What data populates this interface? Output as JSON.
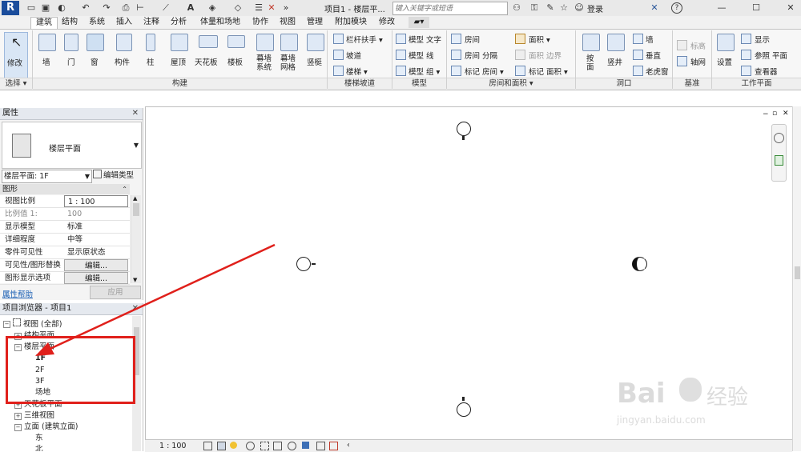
{
  "app": {
    "title": "项目1 - 楼层平...",
    "search_placeholder": "键入关键字或短语",
    "login": "登录"
  },
  "tabs": [
    "建筑",
    "结构",
    "系统",
    "插入",
    "注释",
    "分析",
    "体量和场地",
    "协作",
    "视图",
    "管理",
    "附加模块",
    "修改"
  ],
  "ribbon": {
    "modify": "修改",
    "select": "选择",
    "build": {
      "wall": "墙",
      "door": "门",
      "window": "窗",
      "component": "构件",
      "column": "柱",
      "roof": "屋顶",
      "ceiling": "天花板",
      "floor": "楼板",
      "curtain_system": "幕墙\n系统",
      "curtain_grid": "幕墙\n网格",
      "mullion": "竖梃"
    },
    "stairs": {
      "railing": "栏杆扶手",
      "ramp": "坡道",
      "stair": "楼梯"
    },
    "model": {
      "text": "模型 文字",
      "line": "模型 线",
      "group": "模型 组"
    },
    "room": {
      "room": "房间",
      "separator": "房间 分隔",
      "tag_room": "标记 房间",
      "area": "面积",
      "area_boundary": "面积 边界",
      "tag_area": "标记 面积"
    },
    "opening": {
      "by_face": "按\n面",
      "shaft": "竖井",
      "wall": "墙",
      "vertical": "垂直",
      "dormer": "老虎窗"
    },
    "datum": {
      "level": "标高",
      "grid": "轴网"
    },
    "workplane": {
      "set": "设置",
      "show": "显示",
      "ref_plane": "参照 平面",
      "viewer": "查看器"
    },
    "groups": {
      "build": "构建",
      "stairs": "楼梯坡道",
      "model": "模型",
      "room": "房间和面积",
      "opening": "洞口",
      "datum": "基准",
      "workplane": "工作平面"
    }
  },
  "properties": {
    "title": "属性",
    "type_name": "楼层平面",
    "selector": "楼层平面: 1F",
    "edit_type": "编辑类型",
    "section": "图形",
    "rows": [
      {
        "key": "视图比例",
        "value": "1 : 100"
      },
      {
        "key": "比例值 1:",
        "value": "100"
      },
      {
        "key": "显示模型",
        "value": "标准"
      },
      {
        "key": "详细程度",
        "value": "中等"
      },
      {
        "key": "零件可见性",
        "value": "显示原状态"
      },
      {
        "key": "可见性/图形替换",
        "value": "编辑..."
      },
      {
        "key": "图形显示选项",
        "value": "编辑..."
      }
    ],
    "help": "属性帮助",
    "apply": "应用"
  },
  "browser": {
    "title": "项目浏览器 - 项目1",
    "root": "视图 (全部)",
    "structural": "结构平面",
    "floor_plans": "楼层平面",
    "levels": [
      "1F",
      "2F",
      "3F",
      "场地"
    ],
    "ceiling": "天花板平面",
    "threed": "三维视图",
    "elevation": "立面 (建筑立面)",
    "elev_items": [
      "东",
      "北"
    ]
  },
  "status": {
    "scale": "1 : 100"
  },
  "watermark": {
    "brand": "Bai",
    "cn": "经验",
    "url": "jingyan.baidu.com"
  },
  "colors": {
    "accent": "#2b579a",
    "annotation": "#e0201b",
    "revit_blue": "#1b4d9c"
  }
}
